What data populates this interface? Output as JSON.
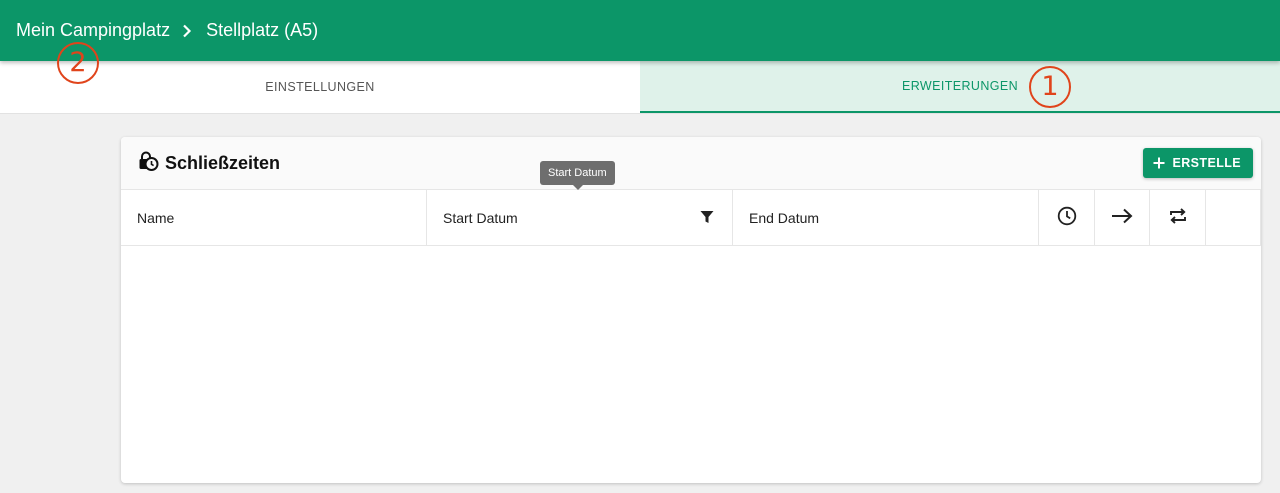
{
  "breadcrumb": {
    "parent": "Mein Campingplatz",
    "current": "Stellplatz (A5)"
  },
  "tabs": [
    {
      "label": "EINSTELLUNGEN",
      "active": false
    },
    {
      "label": "ERWEITERUNGEN",
      "active": true
    }
  ],
  "markers": {
    "one": "1",
    "two": "2"
  },
  "card": {
    "title": "Schließzeiten",
    "create_label": "ERSTELLE"
  },
  "table": {
    "columns": [
      "Name",
      "Start Datum",
      "End Datum"
    ],
    "icon_columns": [
      "clock-icon",
      "arrow-right-icon",
      "repeat-icon"
    ]
  },
  "tooltip": "Start Datum",
  "colors": {
    "primary": "#0c9668",
    "active_tab_bg": "#dff2ea",
    "marker": "#e0441b"
  }
}
